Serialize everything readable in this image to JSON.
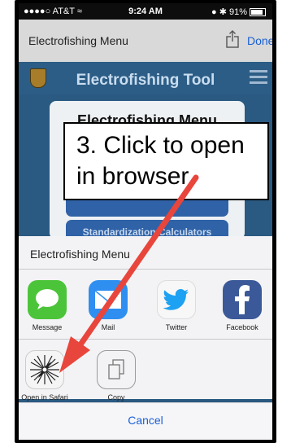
{
  "status_bar": {
    "carrier": "●●●●○ AT&T ≈",
    "time": "9:24 AM",
    "battery": "● ✱ 91%"
  },
  "nav_bar": {
    "title": "Electrofishing Menu",
    "done_label": "Done"
  },
  "app_header": {
    "title": "Electrofishing Tool"
  },
  "menu_panel": {
    "title": "Electrofishing Menu",
    "button_2": "Standardization Calculators"
  },
  "callout": {
    "line1": "3. Click to open",
    "line2": "in browser"
  },
  "share_sheet": {
    "title": "Electrofishing Menu",
    "apps": [
      {
        "label": "Message",
        "icon": "message-icon"
      },
      {
        "label": "Mail",
        "icon": "mail-icon"
      },
      {
        "label": "Twitter",
        "icon": "twitter-icon"
      },
      {
        "label": "Facebook",
        "icon": "facebook-icon"
      }
    ],
    "actions": [
      {
        "label": "Open in Safari",
        "icon": "safari-compass-icon"
      },
      {
        "label": "Copy",
        "icon": "copy-icon"
      }
    ],
    "cancel_label": "Cancel"
  },
  "colors": {
    "link_blue": "#1a5fd4",
    "annotation_arrow": "#e8463c",
    "app_background": "#2c5d86"
  }
}
